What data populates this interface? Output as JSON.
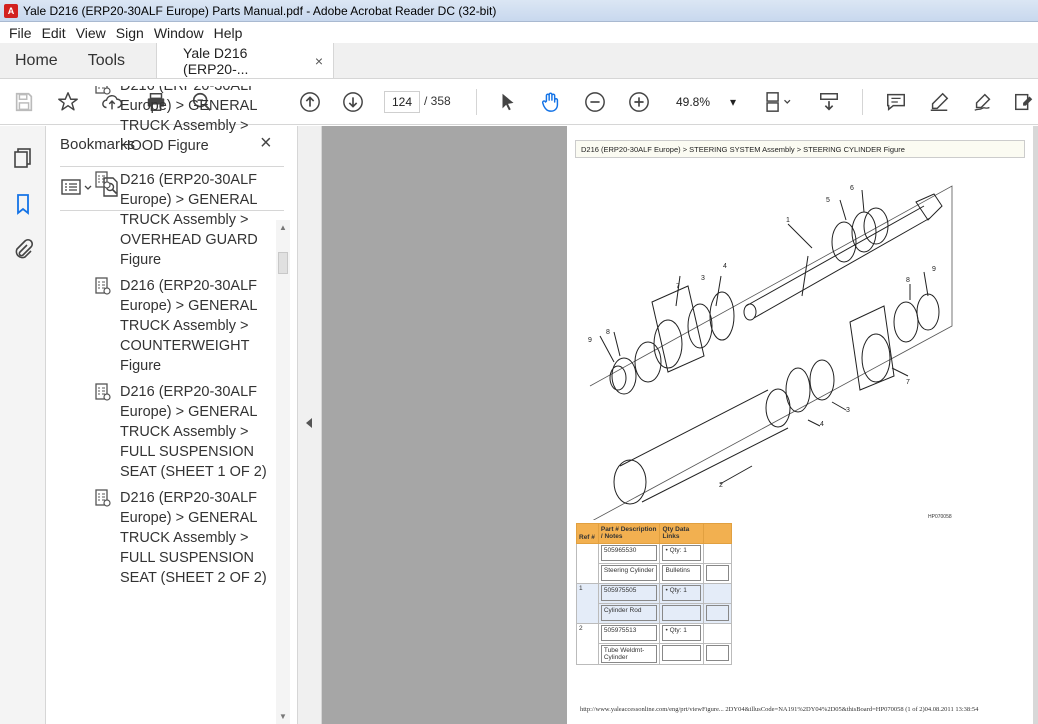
{
  "window": {
    "title": "Yale D216 (ERP20-30ALF Europe) Parts Manual.pdf - Adobe Acrobat Reader DC (32-bit)"
  },
  "menu": [
    "File",
    "Edit",
    "View",
    "Sign",
    "Window",
    "Help"
  ],
  "tabs": {
    "home": "Home",
    "tools": "Tools",
    "doc": "Yale D216 (ERP20-...",
    "close": "×"
  },
  "toolbar": {
    "page_current": "124",
    "page_total": "/ 358",
    "zoom": "49.8%",
    "zoom_caret": "▾"
  },
  "bookmarks": {
    "title": "Bookmarks",
    "close": "×",
    "items": [
      {
        "text": "D216 (ERP20-30ALF Europe) > GENERAL TRUCK Assembly > HOOD Figure"
      },
      {
        "text": "D216 (ERP20-30ALF Europe) > GENERAL TRUCK Assembly > OVERHEAD GUARD Figure"
      },
      {
        "text": "D216 (ERP20-30ALF Europe) > GENERAL TRUCK Assembly > COUNTERWEIGHT Figure"
      },
      {
        "text": "D216 (ERP20-30ALF Europe) > GENERAL TRUCK Assembly > FULL SUSPENSION SEAT (SHEET 1 OF 2)"
      },
      {
        "text": "D216 (ERP20-30ALF Europe) > GENERAL TRUCK Assembly > FULL SUSPENSION SEAT (SHEET 2 OF 2)"
      }
    ]
  },
  "document": {
    "breadcrumb": "D216 (ERP20-30ALF Europe) > STEERING SYSTEM Assembly > STEERING CYLINDER Figure",
    "figure_code": "HP070058",
    "callouts": [
      "1",
      "2",
      "3",
      "4",
      "5",
      "6",
      "7",
      "8",
      "9"
    ],
    "table": {
      "headers": [
        "Ref #",
        "Part # Description / Notes",
        "Qty Data Links"
      ],
      "rows": [
        {
          "ref": "",
          "part": "505965530",
          "qty": "•  Qty: 1",
          "desc": "Steering Cylinder",
          "links": "Bulletins"
        },
        {
          "ref": "1",
          "part": "505975505",
          "qty": "•  Qty: 1",
          "desc": "Cylinder Rod",
          "links": ""
        },
        {
          "ref": "2",
          "part": "505975513",
          "qty": "•  Qty: 1",
          "desc": "Tube Weldmt-Cylinder",
          "links": ""
        }
      ]
    },
    "footer": "http://www.yaleaccessonline.com/eng/prt/viewFigure... 2DY04&illusCode=NA191%2DY04%2D05&thisBoard=HP070058 (1 of 2)04.08.2011 13:38:54"
  }
}
